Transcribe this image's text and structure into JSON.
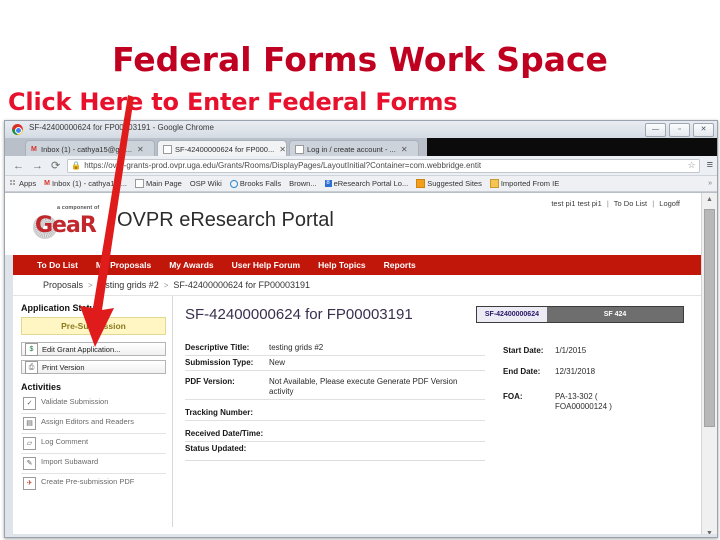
{
  "slide": {
    "title": "Federal Forms Work Space",
    "subtitle": "Click Here to Enter Federal Forms",
    "title_color": "#C00021",
    "subtitle_color": "#E8112D",
    "arrow_color": "#E01B1B"
  },
  "browser": {
    "window_title": "SF-42400000624 for FP00003191 - Google Chrome",
    "window_controls": {
      "minimize": "—",
      "maximize": "▫",
      "close": "✕"
    },
    "tabs": [
      {
        "label": "Inbox (1) - cathya15@gm...",
        "icon": "gmail-icon",
        "active": false
      },
      {
        "label": "SF-42400000624 for FP000...",
        "icon": "page-icon",
        "active": true
      },
      {
        "label": "Log in / create account - ...",
        "icon": "page-icon",
        "active": false
      }
    ],
    "nav": {
      "back": "←",
      "forward": "→",
      "reload": "⟳"
    },
    "omnibox": {
      "lock": "🔒",
      "url": "https://ovpr-grants-prod.ovpr.uga.edu/Grants/Rooms/DisplayPages/LayoutInitial?Container=com.webbridge.entit",
      "star": "☆"
    },
    "chrome_menu": "≡",
    "bookmarks": [
      {
        "label": "Apps",
        "icon": "apps-grid-icon"
      },
      {
        "label": "Inbox (1) - cathya15 ...",
        "icon": "gmail-icon"
      },
      {
        "label": "Main Page",
        "icon": "page-icon"
      },
      {
        "label": "OSP Wiki",
        "icon": "none"
      },
      {
        "label": "Brooks Falls",
        "icon": "explorer-icon"
      },
      {
        "label": "Brown...",
        "icon": "none"
      },
      {
        "label": "eResearch Portal Lo...",
        "icon": "blue-square-icon"
      },
      {
        "label": "Suggested Sites",
        "icon": "orange-square-icon"
      },
      {
        "label": "Imported From IE",
        "icon": "folder-icon"
      }
    ],
    "bookmarks_overflow": "»"
  },
  "portal": {
    "logo": {
      "tagline": "a component of",
      "wordmark": "GeaR"
    },
    "name": "OVPR eResearch Portal",
    "header_links": {
      "user": "test pi1 test pi1",
      "todo": "To Do List",
      "logoff": "Logoff",
      "separator": "|"
    },
    "nav_items": [
      "To Do List",
      "My Proposals",
      "My Awards",
      "User Help Forum",
      "Help Topics",
      "Reports"
    ],
    "nav_bg": "#C1160A",
    "breadcrumb": [
      "Proposals",
      "testing grids #2",
      "SF-42400000624 for FP00003191"
    ],
    "breadcrumb_separator": ">"
  },
  "sidebar": {
    "status_heading": "Application Status",
    "status_value": "Pre-Submission",
    "buttons": [
      {
        "label": "Edit Grant Application...",
        "icon": "edit-grant-icon"
      },
      {
        "label": "Print Version",
        "icon": "printer-icon"
      }
    ],
    "activities_heading": "Activities",
    "activities": [
      {
        "label": "Validate Submission",
        "icon": "validate-icon"
      },
      {
        "label": "Assign Editors and Readers",
        "icon": "clipboard-icon"
      },
      {
        "label": "Log Comment",
        "icon": "comment-icon"
      },
      {
        "label": "Import Subaward",
        "icon": "import-icon"
      },
      {
        "label": "Create Pre-submission PDF",
        "icon": "pdf-icon"
      }
    ]
  },
  "main": {
    "title": "SF-42400000624 for FP00003191",
    "doc_tabs": [
      {
        "label": "SF-42400000624",
        "selected": true
      },
      {
        "label": "SF 424",
        "selected": false
      }
    ],
    "fields_left": [
      {
        "label": "Descriptive Title:",
        "value": "testing grids #2"
      },
      {
        "label": "Submission Type:",
        "value": "New"
      },
      {
        "label": "PDF Version:",
        "value": "Not Available, Please execute Generate PDF Version activity"
      },
      {
        "label": "Tracking Number:",
        "value": ""
      },
      {
        "label": "Received Date/Time:",
        "value": ""
      },
      {
        "label": "Status Updated:",
        "value": ""
      }
    ],
    "fields_right": [
      {
        "label": "Start Date:",
        "value": "1/1/2015"
      },
      {
        "label": "End Date:",
        "value": "12/31/2018"
      },
      {
        "label": "FOA:",
        "value": "PA-13-302 ( FOA00000124 )"
      }
    ]
  },
  "scrollbar": {
    "up": "▲",
    "down": "▼"
  }
}
